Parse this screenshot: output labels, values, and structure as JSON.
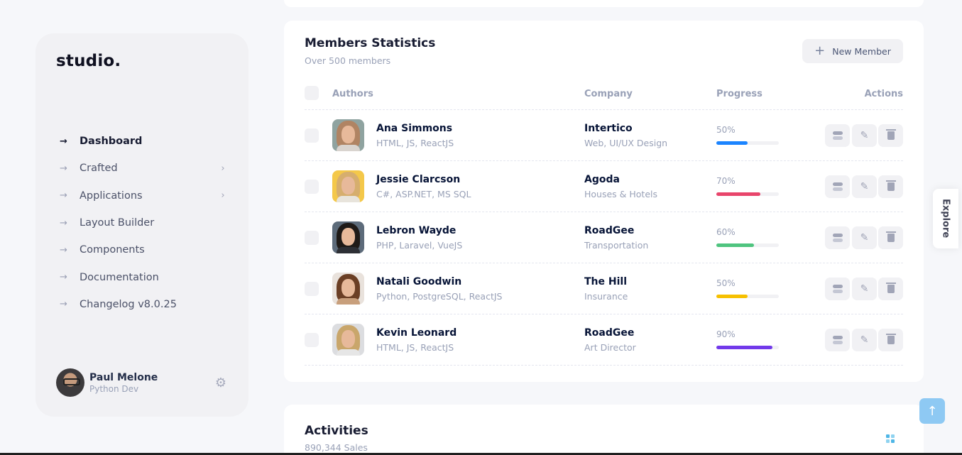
{
  "sidebar": {
    "logo": "studio.",
    "nav": [
      {
        "label": "Dashboard",
        "active": true,
        "submenu": false
      },
      {
        "label": "Crafted",
        "active": false,
        "submenu": true
      },
      {
        "label": "Applications",
        "active": false,
        "submenu": true
      },
      {
        "label": "Layout Builder",
        "active": false,
        "submenu": false
      },
      {
        "label": "Components",
        "active": false,
        "submenu": false
      },
      {
        "label": "Documentation",
        "active": false,
        "submenu": false
      },
      {
        "label": "Changelog v8.0.25",
        "active": false,
        "submenu": false
      }
    ],
    "arrow_glyph": "→",
    "chevron_glyph": "›",
    "user": {
      "name": "Paul Melone",
      "role": "Python Dev"
    }
  },
  "members": {
    "title": "Members Statistics",
    "subtitle": "Over 500 members",
    "new_button": "New Member",
    "columns": [
      "Authors",
      "Company",
      "Progress",
      "Actions"
    ],
    "rows": [
      {
        "name": "Ana Simmons",
        "skills": "HTML, JS, ReactJS",
        "company": "Intertico",
        "company_type": "Web, UI/UX Design",
        "progress": 50,
        "progress_label": "50%",
        "color": "#1b84ff",
        "avatar_bg": "#8fa3a0",
        "hair": "#b08463",
        "shirt": "#d9d4cf"
      },
      {
        "name": "Jessie Clarcson",
        "skills": "C#, ASP.NET, MS SQL",
        "company": "Agoda",
        "company_type": "Houses & Hotels",
        "progress": 70,
        "progress_label": "70%",
        "color": "#e8456b",
        "avatar_bg": "#f4c84a",
        "hair": "#d6ae6e",
        "shirt": "#e8e4dc"
      },
      {
        "name": "Lebron Wayde",
        "skills": "PHP, Laravel, VueJS",
        "company": "RoadGee",
        "company_type": "Transportation",
        "progress": 60,
        "progress_label": "60%",
        "color": "#4fc47f",
        "avatar_bg": "#5d6b7a",
        "hair": "#1f1a17",
        "shirt": "#2d2f35"
      },
      {
        "name": "Natali Goodwin",
        "skills": "Python, PostgreSQL, ReactJS",
        "company": "The Hill",
        "company_type": "Insurance",
        "progress": 50,
        "progress_label": "50%",
        "color": "#f6c000",
        "avatar_bg": "#e9e2dc",
        "hair": "#6b3f25",
        "shirt": "#c89f7c"
      },
      {
        "name": "Kevin Leonard",
        "skills": "HTML, JS, ReactJS",
        "company": "RoadGee",
        "company_type": "Art Director",
        "progress": 90,
        "progress_label": "90%",
        "color": "#7239ea",
        "avatar_bg": "#dcdde0",
        "hair": "#c9a66b",
        "shirt": "#e6e6e6"
      }
    ]
  },
  "activities": {
    "title": "Activities",
    "subtitle": "890,344 Sales"
  },
  "explore_label": "Explore",
  "icons": {
    "plus": "+",
    "pencil": "✎",
    "up_arrow": "↑",
    "gear": "⚙"
  }
}
